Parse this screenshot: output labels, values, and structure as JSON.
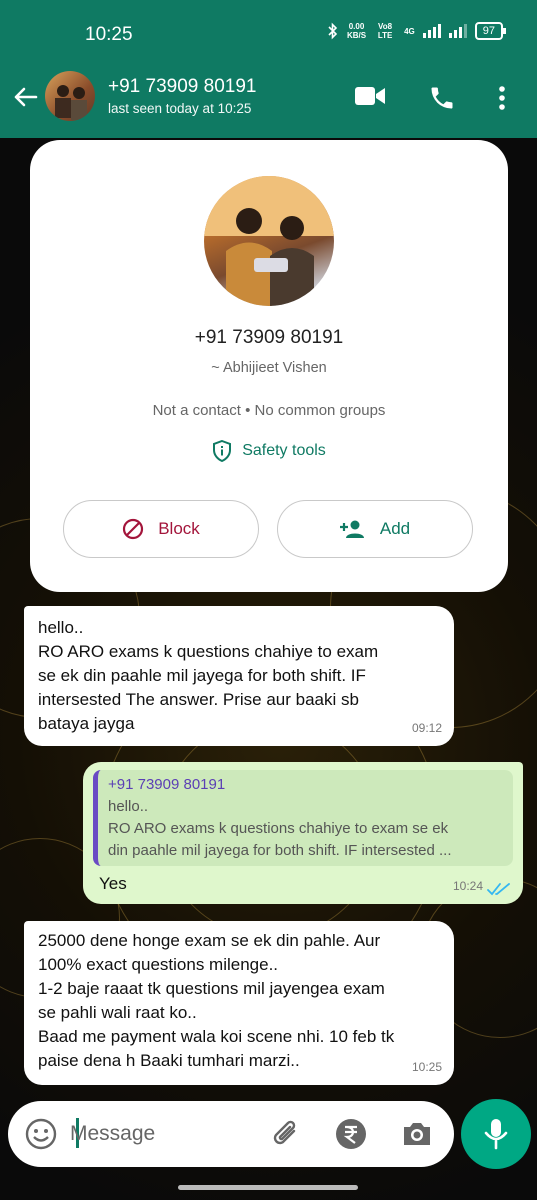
{
  "status_bar": {
    "time": "10:25",
    "net_speed": "0.00",
    "net_unit": "KB/S",
    "volte": "Vo8 LTE",
    "network": "4G",
    "battery": "97"
  },
  "header": {
    "name": "+91 73909 80191",
    "subtitle": "last seen today at 10:25"
  },
  "contact_card": {
    "number": "+91 73909 80191",
    "alias": "~ Abhijieet Vishen",
    "info": "Not a contact • No common groups",
    "safety_label": "Safety tools",
    "block_label": "Block",
    "add_label": "Add"
  },
  "messages": [
    {
      "lines": [
        "hello..",
        "RO ARO exams k questions chahiye to exam",
        "se ek din paahle mil jayega for both shift.   IF",
        "intersested The answer. Prise aur baaki sb",
        "bataya jayga"
      ],
      "time": "09:12"
    },
    {
      "quoted_name": "+91 73909 80191",
      "quoted_lines": [
        "hello..",
        "RO ARO exams k questions chahiye to exam se ek",
        "din paahle mil jayega for both shift.   IF intersested ..."
      ],
      "text": "Yes",
      "time": "10:24"
    },
    {
      "lines": [
        "25000 dene honge exam se ek din pahle. Aur",
        "100% exact questions milenge..",
        "1-2 baje raaat tk questions mil jayengea exam",
        "se pahli wali raat ko..",
        "Baad  me payment wala koi scene nhi. 10 feb tk",
        "paise dena h Baaki tumhari marzi.."
      ],
      "time": "10:25"
    }
  ],
  "input": {
    "placeholder": "Message"
  },
  "colors": {
    "brand": "#0f7a63",
    "outgoing": "#dff7cc",
    "mic": "#00a884",
    "block": "#a3153b",
    "ticks": "#34b7f1"
  }
}
